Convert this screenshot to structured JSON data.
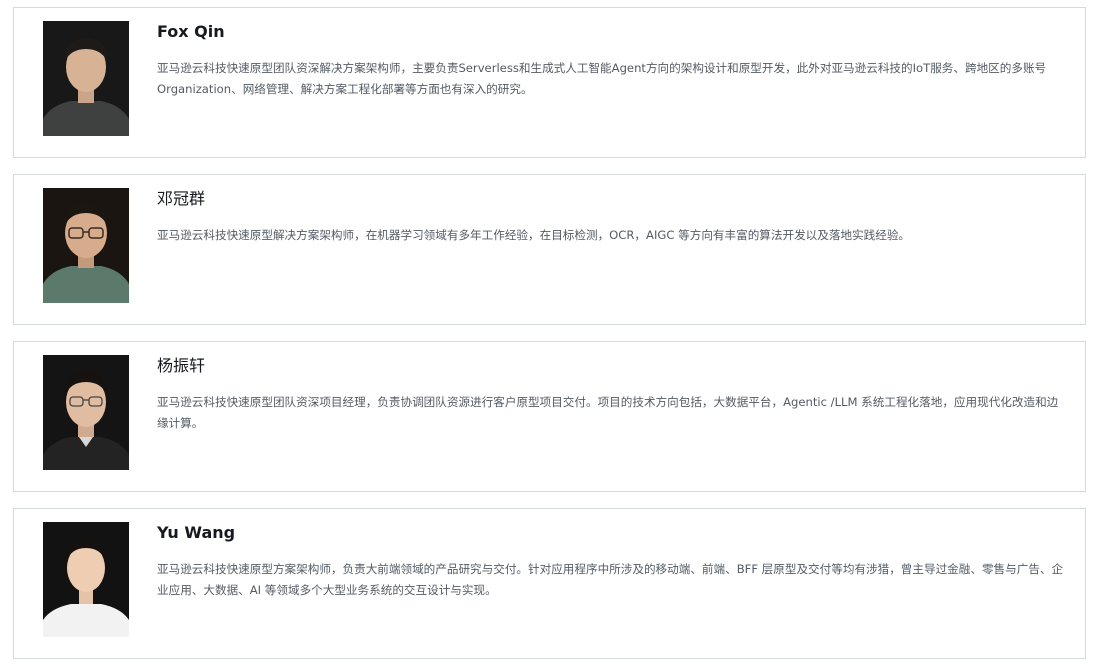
{
  "members": [
    {
      "name": "Fox Qin",
      "bio": "亚马逊云科技快速原型团队资深解决方案架构师，主要负责Serverless和生成式人工智能Agent方向的架构设计和原型开发，此外对亚马逊云科技的IoT服务、跨地区的多账号 Organization、网络管理、解决方案工程化部署等方面也有深入的研究。"
    },
    {
      "name": "邓冠群",
      "bio": "亚马逊云科技快速原型解决方案架构师，在机器学习领域有多年工作经验，在目标检测，OCR，AIGC 等方向有丰富的算法开发以及落地实践经验。"
    },
    {
      "name": "杨振轩",
      "bio": "亚马逊云科技快速原型团队资深项目经理，负责协调团队资源进行客户原型项目交付。项目的技术方向包括，大数据平台，Agentic /LLM 系统工程化落地，应用现代化改造和边缘计算。"
    },
    {
      "name": "Yu Wang",
      "bio": "亚马逊云科技快速原型方案架构师，负责大前端领域的产品研究与交付。针对应用程序中所涉及的移动端、前端、BFF 层原型及交付等均有涉猎，曾主导过金融、零售与广告、企业应用、大数据、AI 等领域多个大型业务系统的交互设计与实现。"
    }
  ]
}
